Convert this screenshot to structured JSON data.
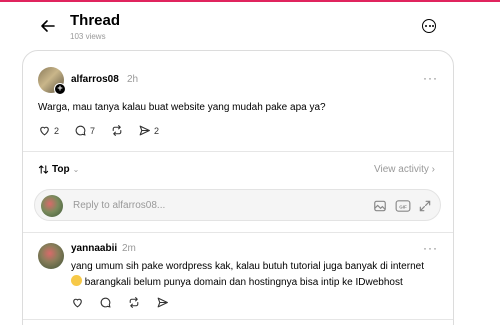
{
  "header": {
    "title": "Thread",
    "views": "103 views"
  },
  "post": {
    "username": "alfarros08",
    "time": "2h",
    "text": "Warga, mau tanya kalau buat website yang mudah pake apa ya?",
    "likes": "2",
    "replies": "7",
    "reposts": "",
    "shares": "2"
  },
  "sort": {
    "label": "Top",
    "view_activity": "View activity"
  },
  "reply_box": {
    "placeholder": "Reply to alfarros08..."
  },
  "comment": {
    "username": "yannaabii",
    "time": "2m",
    "line1": "yang umum sih pake wordpress kak, kalau butuh tutorial juga banyak di internet",
    "line2": "barangkali belum punya domain dan hostingnya bisa intip ke IDwebhost"
  },
  "colors": {
    "accent_line": "#e0245e",
    "muted": "#999999"
  }
}
